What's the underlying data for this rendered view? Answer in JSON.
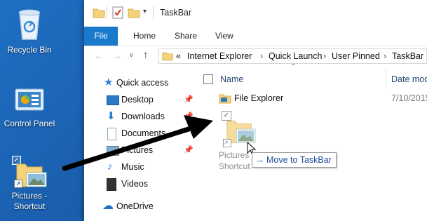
{
  "desktop": {
    "icons": [
      {
        "name": "recycle-bin",
        "label": "Recycle Bin"
      },
      {
        "name": "control-panel",
        "label": "Control Panel"
      },
      {
        "name": "pictures-shortcut",
        "label_line1": "Pictures -",
        "label_line2": "Shortcut"
      }
    ]
  },
  "window": {
    "title": "TaskBar",
    "ribbon_tabs": [
      "File",
      "Home",
      "Share",
      "View"
    ],
    "breadcrumb": {
      "prefix": "«",
      "segments": [
        "Internet Explorer",
        "Quick Launch",
        "User Pinned",
        "TaskBar"
      ]
    },
    "nav": {
      "items": [
        {
          "label": "Quick access",
          "icon": "star-icon"
        },
        {
          "label": "Desktop",
          "icon": "desktop-icon",
          "pinned": true
        },
        {
          "label": "Downloads",
          "icon": "download-icon",
          "pinned": true
        },
        {
          "label": "Documents",
          "icon": "documents-icon"
        },
        {
          "label": "Pictures",
          "icon": "pictures-icon",
          "pinned": true
        },
        {
          "label": "Music",
          "icon": "music-icon"
        },
        {
          "label": "Videos",
          "icon": "videos-icon"
        },
        {
          "label": "OneDrive",
          "icon": "onedrive-icon"
        }
      ]
    },
    "columns": {
      "name": "Name",
      "date": "Date mod"
    },
    "files": [
      {
        "name": "File Explorer",
        "date": "7/10/2015"
      }
    ],
    "drag_ghost": {
      "line1": "Pictures -",
      "line2": "Shortcut"
    },
    "tooltip": {
      "arrow": "→",
      "text": "Move to TaskBar"
    }
  },
  "colors": {
    "accent": "#1979ca",
    "desktop": "#1b5fae",
    "folder": "#f3d27a"
  }
}
